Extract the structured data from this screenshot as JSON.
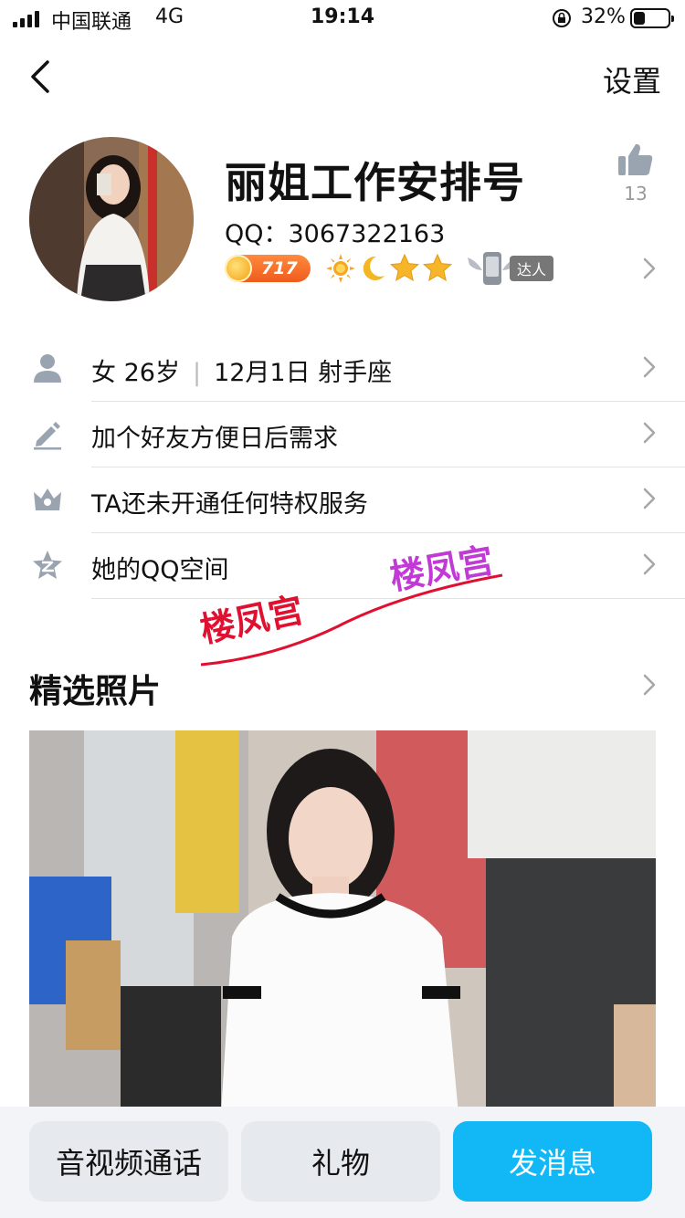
{
  "status_bar": {
    "carrier": "中国联通",
    "network": "4G",
    "time": "19:14",
    "battery_percent": "32%",
    "battery_level": 0.32
  },
  "nav": {
    "settings_label": "设置"
  },
  "profile": {
    "nickname": "丽姐工作安排号",
    "qq_label": "QQ：3067322163",
    "like_count": "13",
    "level_number": "717",
    "talent_label": "达人"
  },
  "info": {
    "gender_age": "女 26岁",
    "separator": "|",
    "birthday": "12月1日 射手座",
    "signature": "加个好友方便日后需求",
    "privilege": "TA还未开通任何特权服务",
    "qzone": "她的QQ空间"
  },
  "watermark": {
    "text1": "楼凤宫",
    "text2": "楼凤宫"
  },
  "photos": {
    "title": "精选照片"
  },
  "bottom_bar": {
    "call_label": "音视频通话",
    "gift_label": "礼物",
    "message_label": "发消息"
  },
  "colors": {
    "accent": "#12b7f5",
    "secondary_button": "#e6e9ee",
    "icon_gray": "#9aa3b0"
  }
}
